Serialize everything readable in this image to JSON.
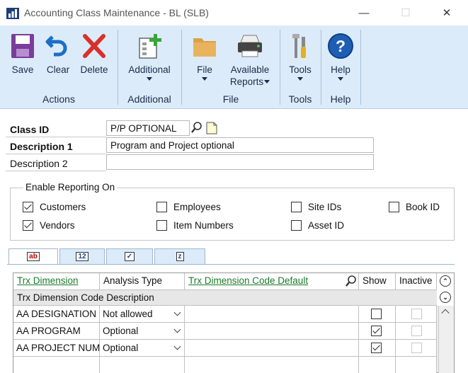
{
  "window": {
    "title": "Accounting Class Maintenance  -  BL (SLB)",
    "minimize_glyph": "—",
    "maximize_glyph": "☐",
    "close_glyph": "✕"
  },
  "ribbon": {
    "actions": {
      "save": "Save",
      "clear": "Clear",
      "delete": "Delete",
      "group": "Actions"
    },
    "additional": {
      "label": "Additional",
      "group": "Additional"
    },
    "file": {
      "file": "File",
      "available_reports": "Available",
      "available_reports_2": "Reports",
      "group": "File"
    },
    "tools": {
      "label": "Tools",
      "group": "Tools"
    },
    "help": {
      "label": "Help",
      "group": "Help"
    },
    "icons": [
      "save-icon",
      "clear-icon",
      "delete-icon",
      "additional-icon",
      "file-icon",
      "printer-icon",
      "tools-icon",
      "help-icon"
    ],
    "colors": {
      "ribbon_bg": "#dcebf9",
      "save": "#7a3d9a",
      "clear": "#1c6fc4",
      "delete": "#d9302b",
      "help": "#1f5fb3",
      "folder": "#d9a24a"
    }
  },
  "form": {
    "class_id_label": "Class ID",
    "class_id_value": "P/P OPTIONAL",
    "description1_label": "Description 1",
    "description1_value": "Program and Project optional",
    "description2_label": "Description 2",
    "description2_value": ""
  },
  "reporting": {
    "legend": "Enable Reporting On",
    "options": [
      {
        "label": "Customers",
        "checked": true
      },
      {
        "label": "Employees",
        "checked": false
      },
      {
        "label": "Site IDs",
        "checked": false
      },
      {
        "label": "Book ID",
        "checked": false
      },
      {
        "label": "Vendors",
        "checked": true
      },
      {
        "label": "Item Numbers",
        "checked": false
      },
      {
        "label": "Asset ID",
        "checked": false
      }
    ]
  },
  "tabs": [
    {
      "icon_text": "ab",
      "active": true
    },
    {
      "icon_text": "12",
      "active": false
    },
    {
      "icon_text": "✓",
      "active": false
    },
    {
      "icon_text": "z",
      "active": false
    }
  ],
  "grid": {
    "headers": {
      "trx_dimension": "Trx Dimension",
      "analysis_type": "Analysis Type",
      "code_default": "Trx Dimension Code Default",
      "show": "Show",
      "inactive": "Inactive",
      "code_description": "Trx Dimension Code Description"
    },
    "rows": [
      {
        "dimension": "AA DESIGNATION",
        "analysis": "Not allowed",
        "default": "",
        "show": false,
        "inactive": false
      },
      {
        "dimension": "AA PROGRAM",
        "analysis": "Optional",
        "default": "",
        "show": true,
        "inactive": false
      },
      {
        "dimension": "AA PROJECT NUMBER",
        "analysis": "Optional",
        "default": "",
        "show": true,
        "inactive": false
      },
      {
        "dimension": "",
        "analysis": "",
        "default": "",
        "show": null,
        "inactive": null
      }
    ],
    "colors": {
      "link_header": "#1a7a2a"
    }
  }
}
